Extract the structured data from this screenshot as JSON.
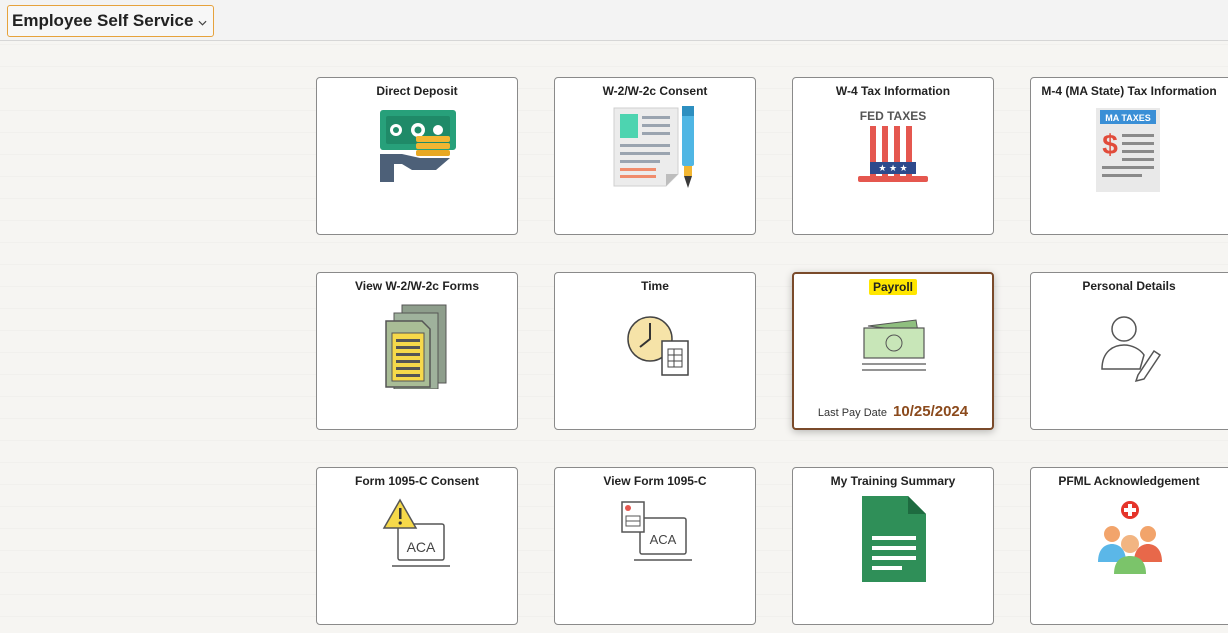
{
  "header": {
    "title": "Employee Self Service"
  },
  "tiles": [
    {
      "label": "Direct Deposit",
      "icon": "direct-deposit-icon"
    },
    {
      "label": "W-2/W-2c Consent",
      "icon": "consent-document-icon"
    },
    {
      "label": "W-4 Tax Information",
      "icon": "fed-taxes-icon",
      "icon_text": "FED TAXES"
    },
    {
      "label": "M-4 (MA State) Tax Information",
      "icon": "ma-taxes-icon",
      "icon_text": "MA TAXES"
    },
    {
      "label": "View W-2/W-2c Forms",
      "icon": "forms-stack-icon"
    },
    {
      "label": "Time",
      "icon": "clock-timesheet-icon"
    },
    {
      "label": "Payroll",
      "icon": "cash-icon",
      "footer_label": "Last Pay Date",
      "footer_value": "10/25/2024"
    },
    {
      "label": "Personal Details",
      "icon": "user-edit-icon"
    },
    {
      "label": "Form 1095-C Consent",
      "icon": "aca-warning-icon",
      "icon_text": "ACA"
    },
    {
      "label": "View Form 1095-C",
      "icon": "aca-form-icon",
      "icon_text": "ACA"
    },
    {
      "label": "My Training Summary",
      "icon": "green-document-icon"
    },
    {
      "label": "PFML Acknowledgement",
      "icon": "people-medical-icon"
    }
  ],
  "colors": {
    "accent": "#e6a23c",
    "selected_border": "#7a4a2a",
    "highlight": "#ffe600",
    "date": "#8b4a1c"
  }
}
